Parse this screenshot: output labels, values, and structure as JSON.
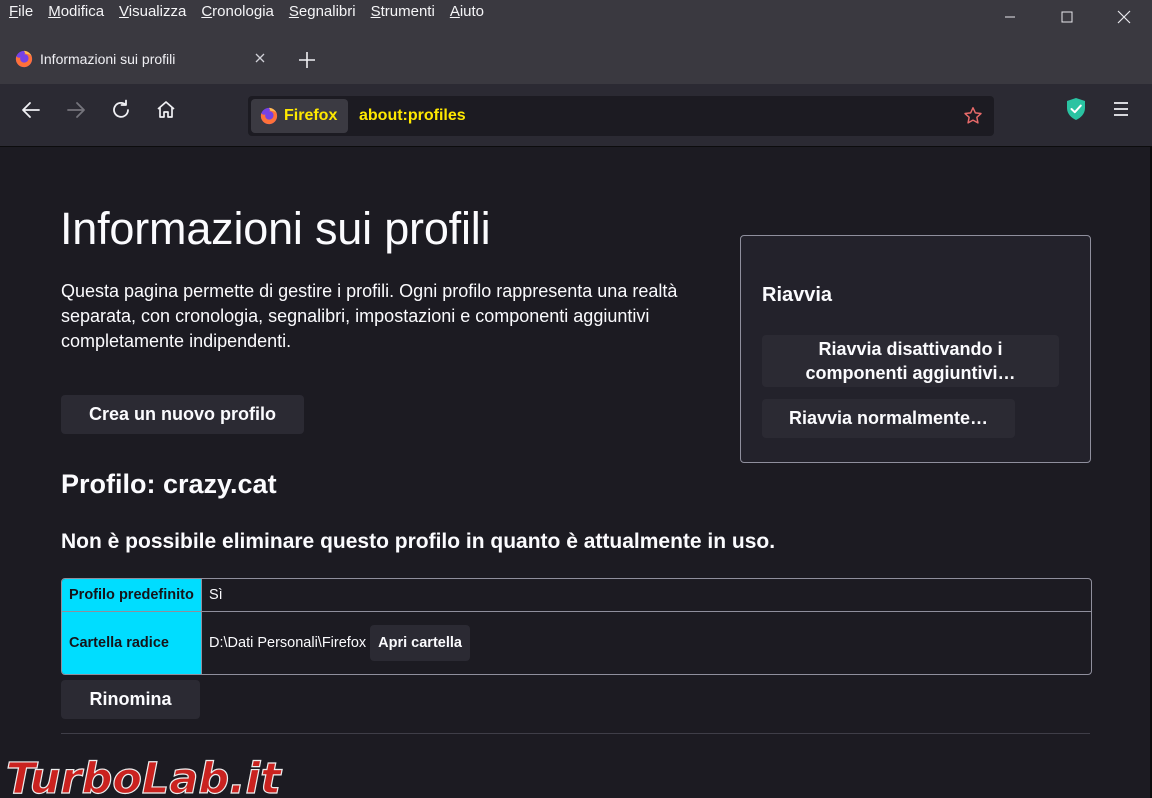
{
  "menu": {
    "items": [
      "File",
      "Modifica",
      "Visualizza",
      "Cronologia",
      "Segnalibri",
      "Strumenti",
      "Aiuto"
    ],
    "accel": [
      "F",
      "M",
      "V",
      "C",
      "S",
      "S",
      "A"
    ]
  },
  "tab": {
    "title": "Informazioni sui profili",
    "icon": "firefox-icon"
  },
  "navbar": {
    "identity_label": "Firefox",
    "url": "about:profiles"
  },
  "page": {
    "title": "Informazioni sui profili",
    "intro": "Questa pagina permette di gestire i profili. Ogni profilo rappresenta una realtà separata, con cronologia, segnalibri, impostazioni e componenti aggiuntivi completamente indipendenti.",
    "create_button": "Crea un nuovo profilo",
    "restart": {
      "title": "Riavvia",
      "safe_mode_button": "Riavvia disattivando i componenti aggiuntivi…",
      "normal_button": "Riavvia normalmente…"
    },
    "profile": {
      "title": "Profilo: crazy.cat",
      "warning": "Non è possibile eliminare questo profilo in quanto è attualmente in uso.",
      "rows": [
        {
          "label": "Profilo predefinito",
          "value": "Sì"
        },
        {
          "label": "Cartella radice",
          "value": "D:\\Dati Personali\\Firefox",
          "button": "Apri cartella"
        }
      ],
      "rename_button": "Rinomina"
    }
  },
  "watermark": {
    "text": "TurboLab.it"
  },
  "colors": {
    "accent_cyan": "#00ddff",
    "url_yellow": "#ffe900",
    "shield_green": "#2ac3a2"
  }
}
